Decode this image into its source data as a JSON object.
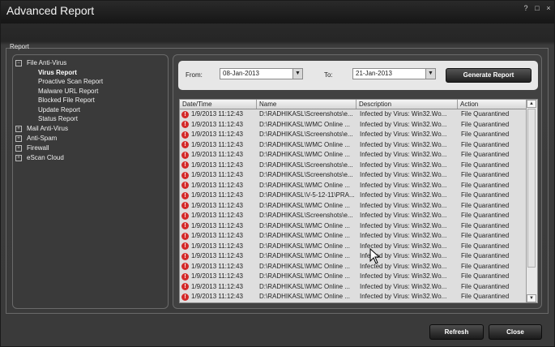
{
  "window": {
    "title": "Advanced Report",
    "controls": [
      "?",
      "□",
      "×"
    ]
  },
  "group_label": "Report",
  "tree": [
    {
      "label": "File Anti-Virus",
      "expanded": true,
      "children": [
        "Virus Report",
        "Proactive Scan Report",
        "Malware URL Report",
        "Blocked File Report",
        "Update Report",
        "Status Report"
      ],
      "selected_child": "Virus Report"
    },
    {
      "label": "Mail Anti-Virus",
      "expanded": false
    },
    {
      "label": "Anti-Spam",
      "expanded": false
    },
    {
      "label": "Firewall",
      "expanded": false
    },
    {
      "label": "eScan Cloud",
      "expanded": false
    }
  ],
  "filters": {
    "from_label": "From:",
    "from_value": "08-Jan-2013",
    "to_label": "To:",
    "to_value": "21-Jan-2013",
    "generate_label": "Generate Report"
  },
  "table": {
    "columns": [
      "Date/Time",
      "Name",
      "Description",
      "Action"
    ],
    "rows": [
      [
        "1/9/2013 11:12:43",
        "D:\\RADHIKASL\\Screenshots\\e...",
        "Infected by Virus: Win32.Wo...",
        "File Quarantined"
      ],
      [
        "1/9/2013 11:12:43",
        "D:\\RADHIKASL\\WMC Online ...",
        "Infected by Virus: Win32.Wo...",
        "File Quarantined"
      ],
      [
        "1/9/2013 11:12:43",
        "D:\\RADHIKASL\\Screenshots\\e...",
        "Infected by Virus: Win32.Wo...",
        "File Quarantined"
      ],
      [
        "1/9/2013 11:12:43",
        "D:\\RADHIKASL\\WMC Online ...",
        "Infected by Virus: Win32.Wo...",
        "File Quarantined"
      ],
      [
        "1/9/2013 11:12:43",
        "D:\\RADHIKASL\\WMC Online ...",
        "Infected by Virus: Win32.Wo...",
        "File Quarantined"
      ],
      [
        "1/9/2013 11:12:43",
        "D:\\RADHIKASL\\Screenshots\\e...",
        "Infected by Virus: Win32.Wo...",
        "File Quarantined"
      ],
      [
        "1/9/2013 11:12:43",
        "D:\\RADHIKASL\\Screenshots\\e...",
        "Infected by Virus: Win32.Wo...",
        "File Quarantined"
      ],
      [
        "1/9/2013 11:12:43",
        "D:\\RADHIKASL\\WMC Online ...",
        "Infected by Virus: Win32.Wo...",
        "File Quarantined"
      ],
      [
        "1/9/2013 11:12:43",
        "D:\\RADHIKASL\\V-5-12-11\\PRA...",
        "Infected by Virus: Win32.Wo...",
        "File Quarantined"
      ],
      [
        "1/9/2013 11:12:43",
        "D:\\RADHIKASL\\WMC Online ...",
        "Infected by Virus: Win32.Wo...",
        "File Quarantined"
      ],
      [
        "1/9/2013 11:12:43",
        "D:\\RADHIKASL\\Screenshots\\e...",
        "Infected by Virus: Win32.Wo...",
        "File Quarantined"
      ],
      [
        "1/9/2013 11:12:43",
        "D:\\RADHIKASL\\WMC Online ...",
        "Infected by Virus: Win32.Wo...",
        "File Quarantined"
      ],
      [
        "1/9/2013 11:12:43",
        "D:\\RADHIKASL\\WMC Online ...",
        "Infected by Virus: Win32.Wo...",
        "File Quarantined"
      ],
      [
        "1/9/2013 11:12:43",
        "D:\\RADHIKASL\\WMC Online ...",
        "Infected by Virus: Win32.Wo...",
        "File Quarantined"
      ],
      [
        "1/9/2013 11:12:43",
        "D:\\RADHIKASL\\WMC Online ...",
        "Infected by Virus: Win32.Wo...",
        "File Quarantined"
      ],
      [
        "1/9/2013 11:12:43",
        "D:\\RADHIKASL\\WMC Online ...",
        "Infected by Virus: Win32.Wo...",
        "File Quarantined"
      ],
      [
        "1/9/2013 11:12:43",
        "D:\\RADHIKASL\\WMC Online ...",
        "Infected by Virus: Win32.Wo...",
        "File Quarantined"
      ],
      [
        "1/9/2013 11:12:43",
        "D:\\RADHIKASL\\WMC Online ...",
        "Infected by Virus: Win32.Wo...",
        "File Quarantined"
      ],
      [
        "1/9/2013 11:12:43",
        "D:\\RADHIKASL\\WMC Online ...",
        "Infected by Virus: Win32.Wo...",
        "File Quarantined"
      ]
    ]
  },
  "buttons": {
    "refresh": "Refresh",
    "close": "Close"
  },
  "colors": {
    "error_icon": "#d42a2a",
    "accent_button": "#1f1f1f"
  },
  "icons": {
    "row_status": "error-icon"
  }
}
